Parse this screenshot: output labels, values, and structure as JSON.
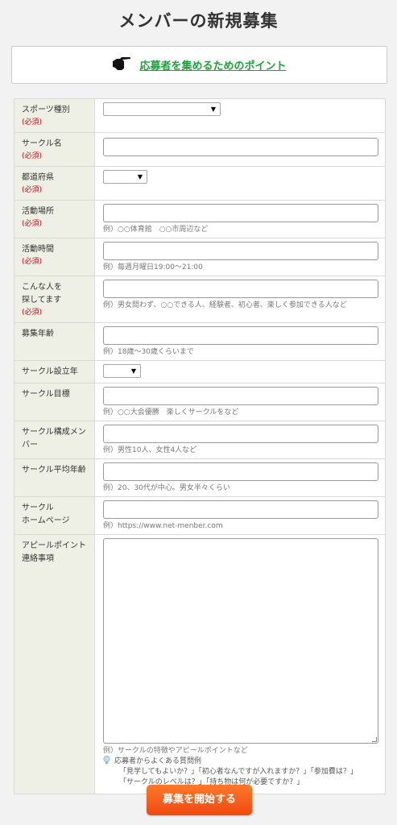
{
  "page": {
    "title": "メンバーの新規募集"
  },
  "point": {
    "link": "応募者を集めるためのポイント",
    "icon": "pointing-hand-icon"
  },
  "required_mark": "(必須)",
  "fields": {
    "sport": {
      "label": "スポーツ種別"
    },
    "circle_name": {
      "label": "サークル名"
    },
    "prefecture": {
      "label": "都道府県"
    },
    "place": {
      "label": "活動場所",
      "example": "例）○○体育館　○○市周辺など"
    },
    "time": {
      "label": "活動時間",
      "example": "例）毎週月曜日19:00〜21:00"
    },
    "seeking": {
      "label1": "こんな人を",
      "label2": "探してます",
      "example": "例）男女問わず、○○できる人、経験者、初心者、楽しく参加できる人など"
    },
    "age": {
      "label": "募集年齢",
      "example": "例）18歳〜30歳くらいまで"
    },
    "founded": {
      "label": "サークル設立年"
    },
    "goal": {
      "label": "サークル目標",
      "example": "例）○○大会優勝　楽しくサークルをなど"
    },
    "members": {
      "label1": "サークル構成メン",
      "label2": "バー",
      "example": "例）男性10人、女性4人など"
    },
    "avg_age": {
      "label": "サークル平均年齢",
      "example": "例）20、30代が中心。男女半々くらい"
    },
    "homepage": {
      "label1": "サークル",
      "label2": "ホームページ",
      "example": "例）https://www.net-menber.com"
    },
    "appeal": {
      "label1": "アピールポイント",
      "label2": "連絡事項",
      "example": "例）サークルの特徴やアピールポイントなど",
      "faq_title": "応募者からよくある質問例",
      "faq_line1": "「見学してもよいか？」「初心者なんですが入れますか？」「参加費は？」",
      "faq_line2": "「サークルのレベルは？」「持ち物は何が必要ですか？」"
    }
  },
  "submit": {
    "label": "募集を開始する"
  },
  "colors": {
    "accent_green": "#1aa33c",
    "required_red": "#e0001a",
    "button_orange": "#f55a1a",
    "label_bg": "#eef0e5"
  }
}
